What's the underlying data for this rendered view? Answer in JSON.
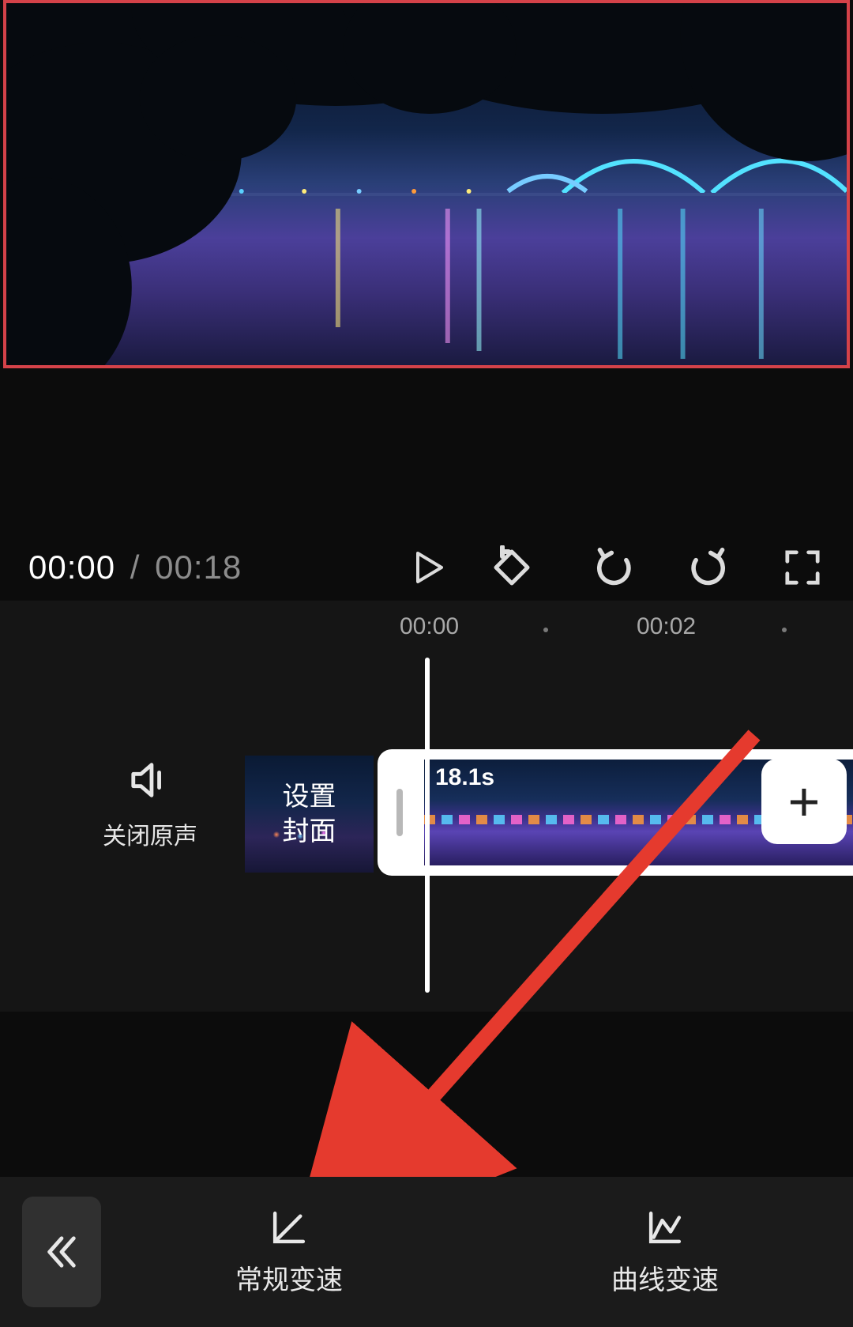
{
  "time": {
    "current": "00:00",
    "separator": "/",
    "total": "00:18"
  },
  "ruler": {
    "tick_0": "00:00",
    "tick_2": "00:02"
  },
  "mute": {
    "label": "关闭原声"
  },
  "cover": {
    "label": "设置\n封面"
  },
  "clip": {
    "duration": "18.1s"
  },
  "add_clip": {
    "label": "+"
  },
  "toolbar": {
    "normal_speed": "常规变速",
    "curve_speed": "曲线变速"
  },
  "icons": {
    "play": "play-icon",
    "keyframe": "keyframe-icon",
    "undo": "undo-icon",
    "redo": "redo-icon",
    "fullscreen": "fullscreen-icon",
    "speaker": "speaker-icon",
    "back": "double-chevron-left-icon",
    "normal_speed": "speed-normal-icon",
    "curve_speed": "speed-curve-icon"
  }
}
